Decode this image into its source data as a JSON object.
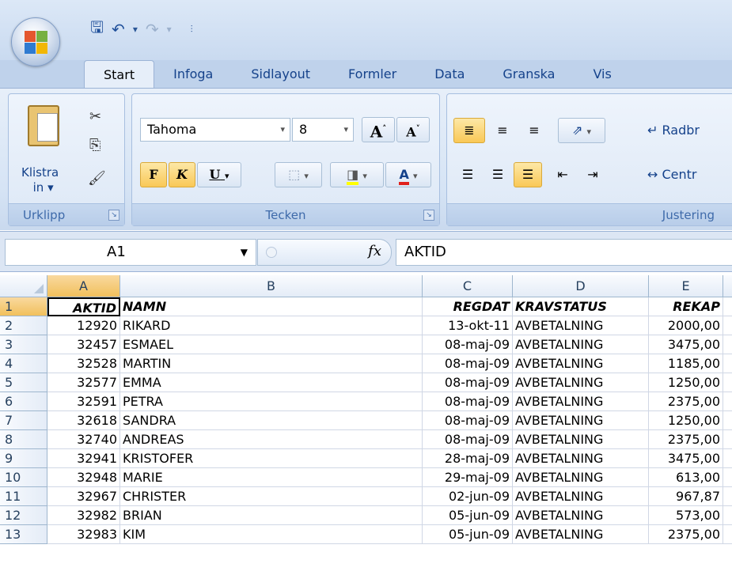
{
  "qat": {
    "icons": [
      "save-icon",
      "undo-icon",
      "redo-icon",
      "customize-icon"
    ]
  },
  "tabs": [
    "Start",
    "Infoga",
    "Sidlayout",
    "Formler",
    "Data",
    "Granska",
    "Vis"
  ],
  "active_tab": "Start",
  "ribbon": {
    "clipboard": {
      "paste_label_1": "Klistra",
      "paste_label_2": "in ▾",
      "group": "Urklipp"
    },
    "font": {
      "name": "Tahoma",
      "size": "8",
      "bold": "F",
      "italic": "K",
      "underline": "U",
      "grow": "A",
      "shrink": "A",
      "color": "A",
      "group": "Tecken"
    },
    "alignment": {
      "wrap": "Radbr",
      "merge": "Centr",
      "group": "Justering"
    }
  },
  "formula_bar": {
    "name_box": "A1",
    "fx": "fx",
    "content": "AKTID"
  },
  "columns": [
    "A",
    "B",
    "C",
    "D",
    "E"
  ],
  "rows": [
    {
      "n": "1",
      "a": "AKTID",
      "b": "NAMN",
      "c": "REGDAT",
      "d": "KRAVSTATUS",
      "e": "REKAP"
    },
    {
      "n": "2",
      "a": "12920",
      "b": "RIKARD",
      "c": "13-okt-11",
      "d": "AVBETALNING",
      "e": "2000,00"
    },
    {
      "n": "3",
      "a": "32457",
      "b": "ESMAEL",
      "c": "08-maj-09",
      "d": "AVBETALNING",
      "e": "3475,00"
    },
    {
      "n": "4",
      "a": "32528",
      "b": "MARTIN",
      "c": "08-maj-09",
      "d": "AVBETALNING",
      "e": "1185,00"
    },
    {
      "n": "5",
      "a": "32577",
      "b": "EMMA",
      "c": "08-maj-09",
      "d": "AVBETALNING",
      "e": "1250,00"
    },
    {
      "n": "6",
      "a": "32591",
      "b": "PETRA",
      "c": "08-maj-09",
      "d": "AVBETALNING",
      "e": "2375,00"
    },
    {
      "n": "7",
      "a": "32618",
      "b": "SANDRA",
      "c": "08-maj-09",
      "d": "AVBETALNING",
      "e": "1250,00"
    },
    {
      "n": "8",
      "a": "32740",
      "b": "ANDREAS",
      "c": "08-maj-09",
      "d": "AVBETALNING",
      "e": "2375,00"
    },
    {
      "n": "9",
      "a": "32941",
      "b": "KRISTOFER",
      "c": "28-maj-09",
      "d": "AVBETALNING",
      "e": "3475,00"
    },
    {
      "n": "10",
      "a": "32948",
      "b": "MARIE",
      "c": "29-maj-09",
      "d": "AVBETALNING",
      "e": "613,00"
    },
    {
      "n": "11",
      "a": "32967",
      "b": "CHRISTER",
      "c": "02-jun-09",
      "d": "AVBETALNING",
      "e": "967,87"
    },
    {
      "n": "12",
      "a": "32982",
      "b": "BRIAN",
      "c": "05-jun-09",
      "d": "AVBETALNING",
      "e": "573,00"
    },
    {
      "n": "13",
      "a": "32983",
      "b": "KIM",
      "c": "05-jun-09",
      "d": "AVBETALNING",
      "e": "2375,00"
    }
  ]
}
